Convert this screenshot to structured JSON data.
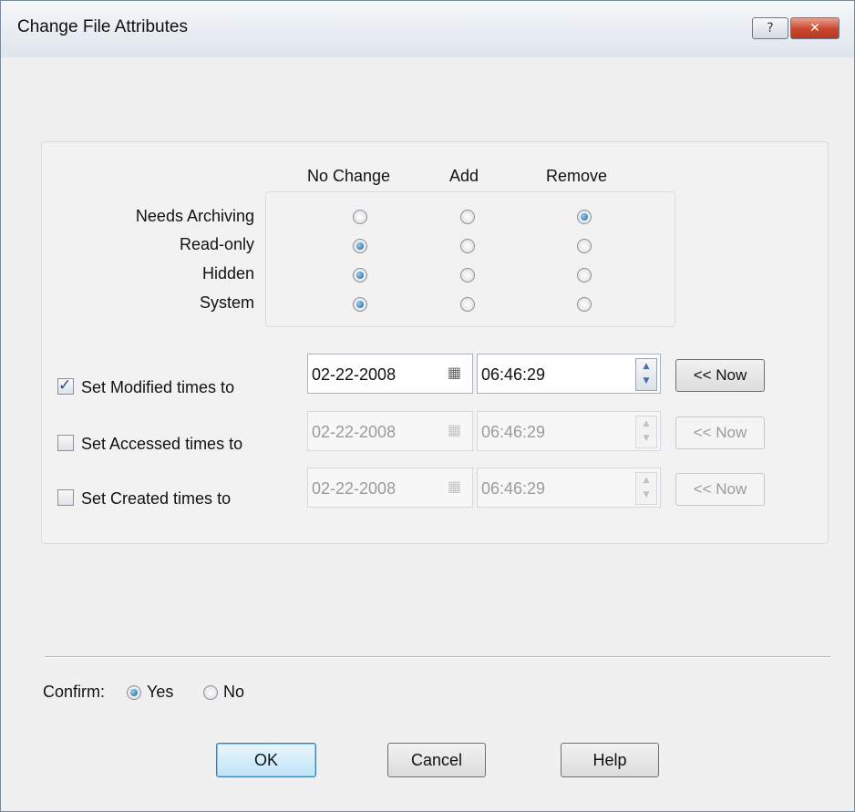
{
  "window": {
    "title": "Change File Attributes",
    "help_glyph": "?",
    "close_glyph": "✕"
  },
  "attributes": {
    "columns": [
      "No Change",
      "Add",
      "Remove"
    ],
    "rows": [
      {
        "label": "Needs Archiving",
        "selected": "Remove"
      },
      {
        "label": "Read-only",
        "selected": "No Change"
      },
      {
        "label": "Hidden",
        "selected": "No Change"
      },
      {
        "label": "System",
        "selected": "No Change"
      }
    ]
  },
  "times": {
    "now_label": "<< Now",
    "rows": [
      {
        "label": "Set Modified times to",
        "checked": true,
        "date": "02-22-2008",
        "time": "06:46:29"
      },
      {
        "label": "Set Accessed times to",
        "checked": false,
        "date": "02-22-2008",
        "time": "06:46:29"
      },
      {
        "label": "Set Created times to",
        "checked": false,
        "date": "02-22-2008",
        "time": "06:46:29"
      }
    ]
  },
  "confirm": {
    "label": "Confirm:",
    "yes": "Yes",
    "no": "No",
    "selected": "Yes"
  },
  "buttons": {
    "ok": "OK",
    "cancel": "Cancel",
    "help": "Help"
  },
  "icons": {
    "calendar": "calendar-icon",
    "spin_up": "spin-up-icon",
    "spin_down": "spin-down-icon"
  }
}
